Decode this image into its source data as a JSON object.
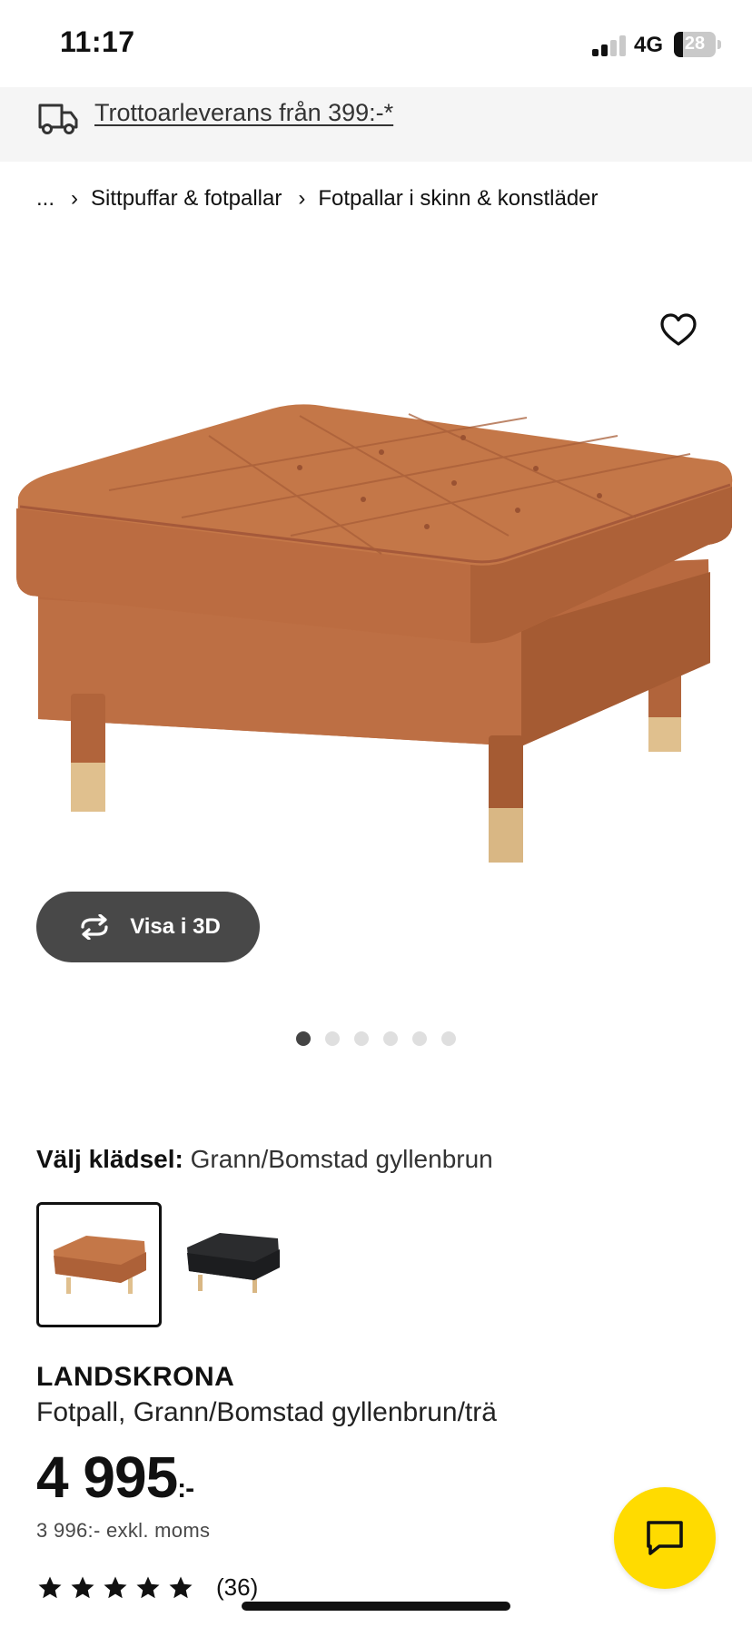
{
  "status_bar": {
    "time": "11:17",
    "network": "4G",
    "battery": "28"
  },
  "banner": {
    "text": "Trottoarleverans från 399:-*",
    "icon": "truck-icon"
  },
  "breadcrumb": {
    "items": [
      "...",
      "Sittpuffar & fotpallar",
      "Fotpallar i skinn & konstläder"
    ],
    "separator": "›"
  },
  "gallery": {
    "view_3d_label": "Visa i 3D",
    "image_count": 6,
    "active_index": 0
  },
  "cover": {
    "label": "Välj klädsel:",
    "value": "Grann/Bomstad gyllenbrun",
    "options": [
      {
        "color": "#c07446",
        "selected": true
      },
      {
        "color": "#2b2c2e",
        "selected": false
      }
    ]
  },
  "product": {
    "name": "LANDSKRONA",
    "description": "Fotpall, Grann/Bomstad gyllenbrun/trä",
    "price": "4 995",
    "price_suffix": ":-",
    "price_ex_vat": "3 996:- exkl. moms",
    "rating_stars": 5,
    "review_count": "(36)"
  },
  "colors": {
    "accent_yellow": "#ffdb00",
    "leather": "#c07446",
    "wood": "#e0c08e"
  }
}
